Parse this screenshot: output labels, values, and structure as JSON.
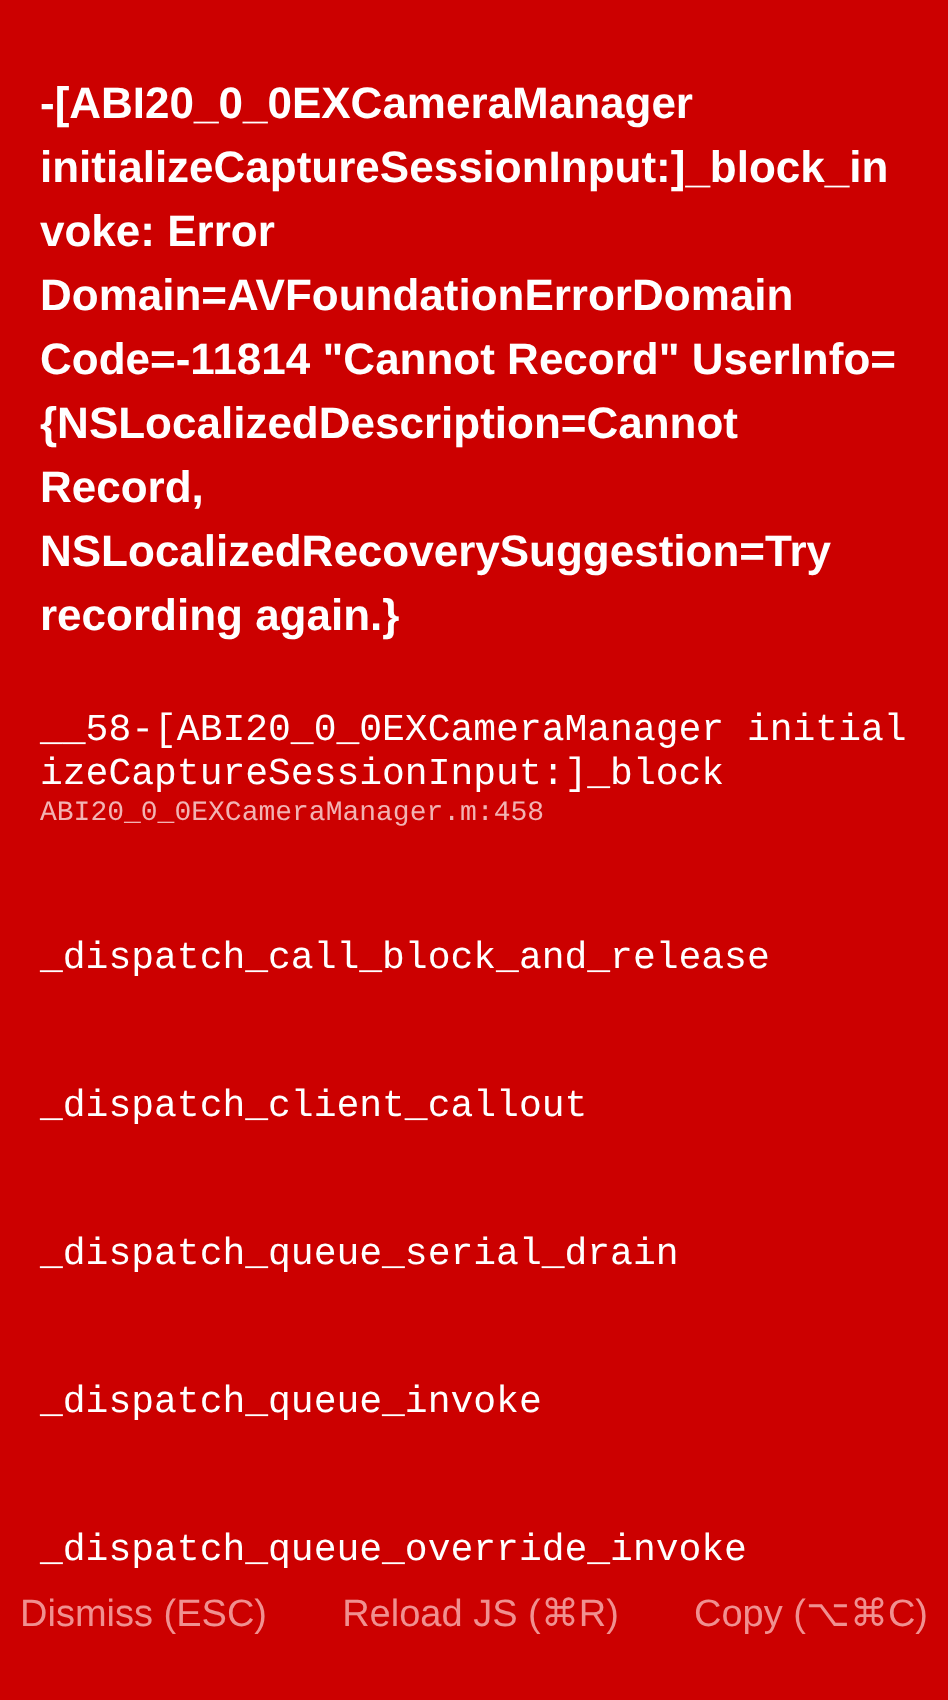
{
  "message": "-[ABI20_0_0EXCameraManager initializeCaptureSessionInput:]_block_invoke: Error Domain=AVFoundationErrorDomain Code=-11814 \"Cannot Record\" UserInfo={NSLocalizedDescription=Cannot Record, NSLocalizedRecoverySuggestion=Try recording again.}",
  "stack": [
    {
      "method": "__58-[ABI20_0_0EXCameraManager initializeCaptureSessionInput:]_block",
      "file": "ABI20_0_0EXCameraManager.m:458"
    },
    {
      "method": "_dispatch_call_block_and_release"
    },
    {
      "method": "_dispatch_client_callout"
    },
    {
      "method": "_dispatch_queue_serial_drain"
    },
    {
      "method": "_dispatch_queue_invoke"
    },
    {
      "method": "_dispatch_queue_override_invoke"
    }
  ],
  "buttons": [
    "Dismiss (ESC)",
    "Reload JS (⌘R)",
    "Copy (⌥⌘C)"
  ]
}
